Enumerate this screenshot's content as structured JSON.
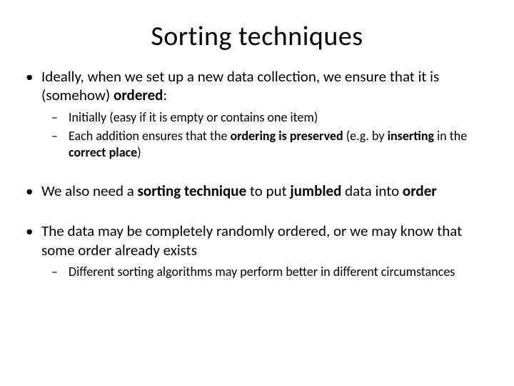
{
  "title": "Sorting techniques",
  "bullets": [
    {
      "pre": "Ideally, when we set up a new data collection, we ensure that it is (somehow) ",
      "bold1": "ordered",
      "post1": ":",
      "sub": [
        {
          "text": "Initially (easy if it is empty or contains one item)"
        },
        {
          "pre": "Each addition ensures that the ",
          "bold1": "ordering is preserved",
          "mid": " (e.g. by ",
          "bold2": "inserting",
          "post": " in the ",
          "bold3": "correct place",
          "tail": ")"
        }
      ]
    },
    {
      "pre": "We also need a ",
      "bold1": "sorting technique",
      "mid": " to put ",
      "bold2": "jumbled",
      "post": " data into ",
      "bold3": "order",
      "tail": ""
    },
    {
      "text": "The data may be completely randomly ordered, or we may know that some order already exists",
      "sub": [
        {
          "text": "Different sorting algorithms may perform better in different circumstances"
        }
      ]
    }
  ]
}
